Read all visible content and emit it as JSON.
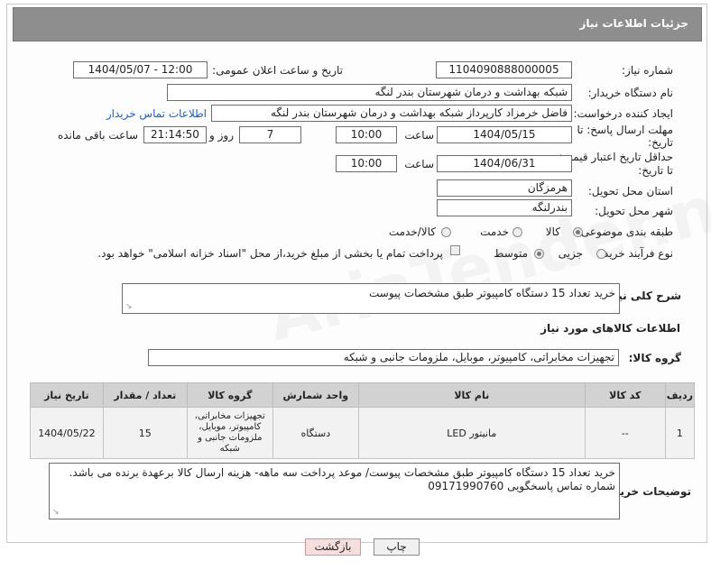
{
  "header": {
    "title": "جزئیات اطلاعات نیاز"
  },
  "form": {
    "need_number": {
      "label": "شماره نیاز:",
      "value": "1104090888000005"
    },
    "announce": {
      "label": "تاریخ و ساعت اعلان عمومی:",
      "value": "1404/05/07 - 12:00"
    },
    "buyer_org": {
      "label": "نام دستگاه خریدار:",
      "value": "شبکه بهداشت و درمان شهرستان بندر لنگه"
    },
    "creator": {
      "label": "ایجاد کننده درخواست:",
      "value": "فاضل خرمزاد کارپرداز شبکه بهداشت و درمان شهرستان بندر لنگه",
      "contact_link": "اطلاعات تماس خریدار"
    },
    "reply_deadline": {
      "label_line1": "مهلت ارسال پاسخ: تا",
      "label_line2": "تاریخ:",
      "date": "1404/05/15",
      "time_label": "ساعت",
      "time": "10:00",
      "days": "7",
      "days_label": "روز و",
      "remaining": "21:14:50",
      "remaining_label": "ساعت باقی مانده"
    },
    "price_validity": {
      "label_line1": "حداقل تاریخ اعتبار قیمت:",
      "label_line2": "تا تاریخ:",
      "date": "1404/06/31",
      "time_label": "ساعت",
      "time": "10:00"
    },
    "province": {
      "label": "استان محل تحویل:",
      "value": "هرمزگان"
    },
    "city": {
      "label": "شهر محل تحویل:",
      "value": "بندرلنگه"
    },
    "category": {
      "label": "طبقه بندی موضوعی:",
      "options": [
        "کالا",
        "خدمت",
        "کالا/خدمت"
      ],
      "selected": "کالا"
    },
    "purchase_type": {
      "label": "نوع فرآیند خرید :",
      "options": [
        "جزیی",
        "متوسط"
      ],
      "selected": "متوسط",
      "payment_note": "پرداخت تمام یا بخشی از مبلغ خرید،از محل \"اسناد خزانه اسلامی\" خواهد بود."
    }
  },
  "general_desc": {
    "label": "شرح کلی نیاز:",
    "value": "خرید تعداد 15 دستگاه کامپیوتر طبق مشخصات پیوست"
  },
  "goods_section": {
    "title": "اطلاعات کالاهای مورد نیاز",
    "group_label": "گروه کالا:",
    "group_value": "تجهیزات مخابراتی، کامپیوتر، موبایل، ملزومات جانبی و شبکه"
  },
  "table": {
    "headers": [
      "ردیف",
      "کد کالا",
      "نام کالا",
      "واحد شمارش",
      "گروه کالا",
      "تعداد / مقدار",
      "تاریخ نیاز"
    ],
    "rows": [
      [
        "1",
        "--",
        "مانیتور LED",
        "دستگاه",
        "تجهیزات مخابراتی، کامپیوتر، موبایل، ملزومات جانبی و شبکه",
        "15",
        "1404/05/22"
      ]
    ]
  },
  "buyer_notes": {
    "label": "توضیحات خریدار:",
    "line1": "خرید تعداد 15 دستگاه کامپیوتر طبق مشخصات پیوست/ موعد پرداخت سه ماهه- هزینه ارسال کالا برعهدة برنده می باشد.",
    "line2": "شماره تماس پاسخگویی 09171990760"
  },
  "buttons": {
    "print": "چاپ",
    "back": "بازگشت"
  },
  "watermark": "AriaTender.net",
  "colors": {
    "title_bar": "#8e8e8e",
    "link": "#1f5fbf",
    "back_button_bg": "#f6dede"
  }
}
